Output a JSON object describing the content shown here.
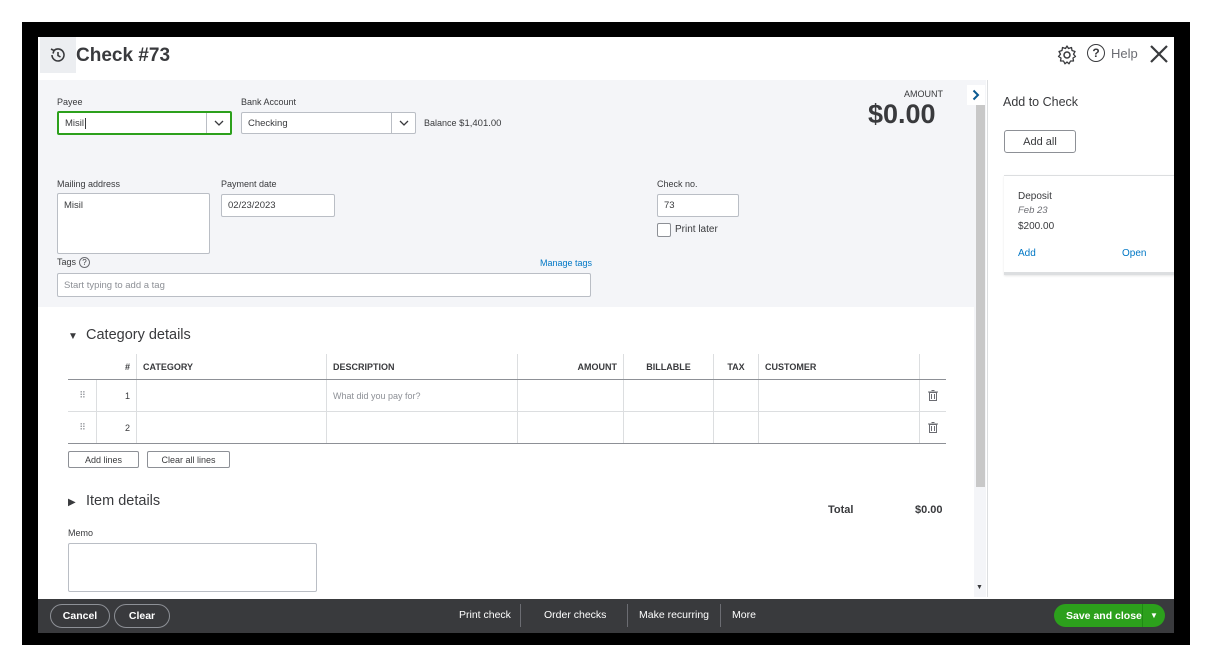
{
  "header": {
    "title": "Check #73",
    "help_label": "Help"
  },
  "form": {
    "payee_label": "Payee",
    "payee_value": "Misil",
    "bank_account_label": "Bank Account",
    "bank_account_value": "Checking",
    "balance_label": "Balance",
    "balance_value": "$1,401.00",
    "amount_label": "AMOUNT",
    "amount_value": "$0.00",
    "mailing_address_label": "Mailing address",
    "mailing_address_value": "Misil",
    "payment_date_label": "Payment date",
    "payment_date_value": "02/23/2023",
    "check_no_label": "Check no.",
    "check_no_value": "73",
    "print_later_label": "Print later",
    "tags_label": "Tags",
    "tags_help": "?",
    "manage_tags_label": "Manage tags",
    "tags_placeholder": "Start typing to add a tag"
  },
  "category": {
    "title": "Category details",
    "columns": [
      "#",
      "CATEGORY",
      "DESCRIPTION",
      "AMOUNT",
      "BILLABLE",
      "TAX",
      "CUSTOMER"
    ],
    "rows": [
      {
        "num": "1",
        "description_placeholder": "What did you pay for?"
      },
      {
        "num": "2",
        "description_placeholder": ""
      }
    ],
    "add_lines_label": "Add lines",
    "clear_lines_label": "Clear all lines"
  },
  "item": {
    "title": "Item details"
  },
  "totals": {
    "total_label": "Total",
    "total_value": "$0.00"
  },
  "memo": {
    "label": "Memo"
  },
  "panel": {
    "title": "Add to Check",
    "add_all_label": "Add all",
    "card": {
      "type": "Deposit",
      "date": "Feb 23",
      "amount": "$200.00",
      "add_label": "Add",
      "open_label": "Open"
    }
  },
  "footer": {
    "cancel_label": "Cancel",
    "clear_label": "Clear",
    "print_check_label": "Print check",
    "order_checks_label": "Order checks",
    "make_recurring_label": "Make recurring",
    "more_label": "More",
    "save_label": "Save and close"
  },
  "colors": {
    "accent_green": "#2ca01c",
    "link_blue": "#0077c5",
    "footer_bg": "#393a3d",
    "section_bg": "#f4f5f8"
  }
}
